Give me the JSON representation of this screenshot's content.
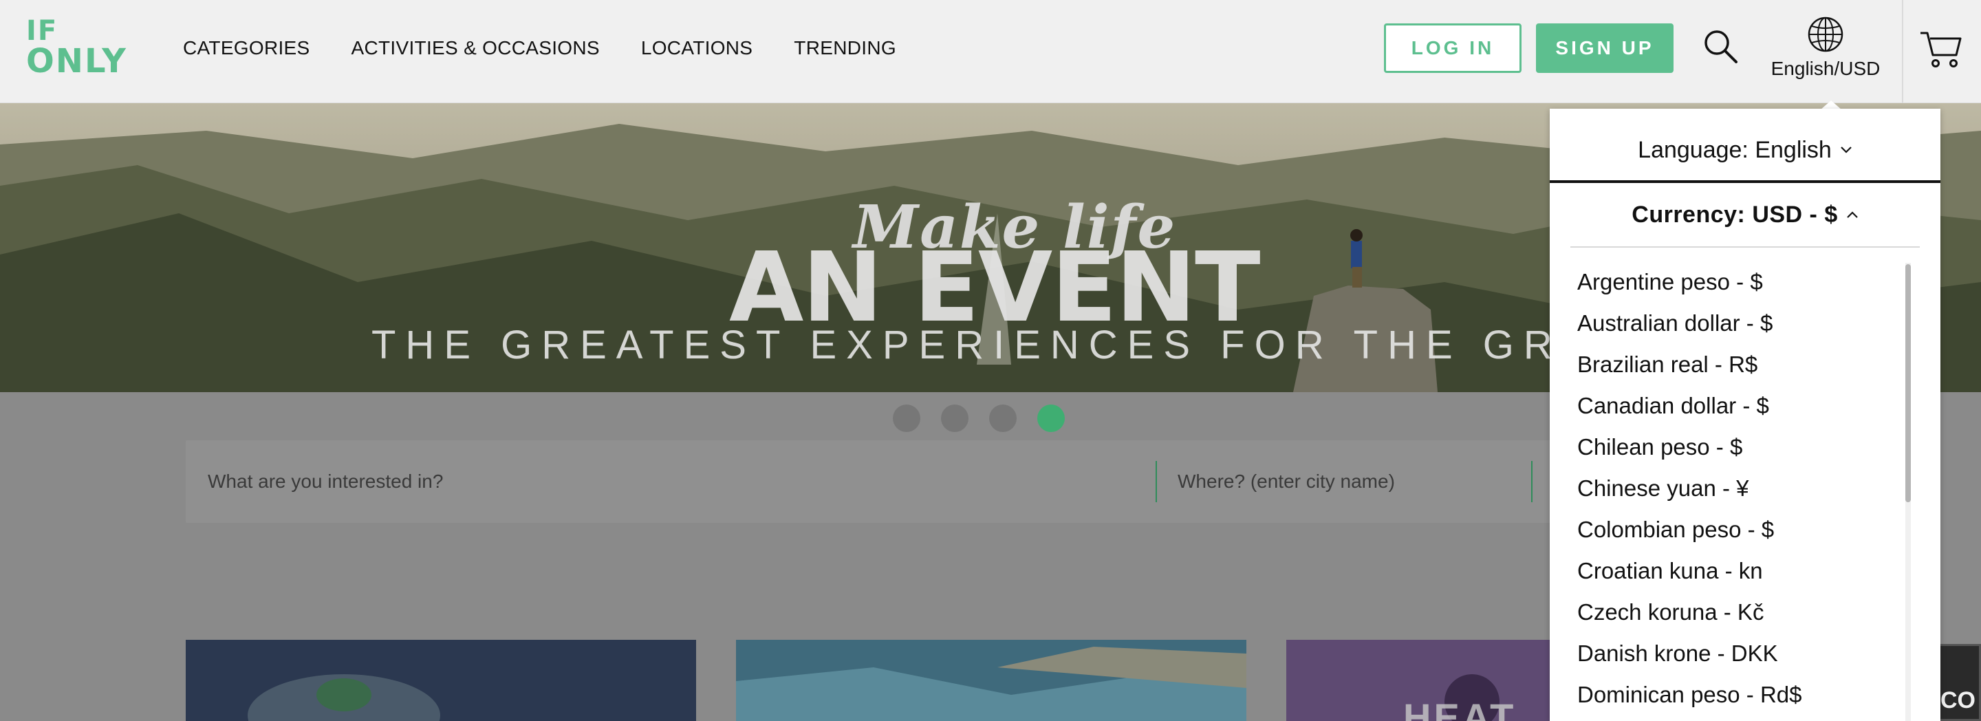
{
  "header": {
    "logo": {
      "line1": "IF",
      "line2": "ONLY"
    },
    "nav": [
      "CATEGORIES",
      "ACTIVITIES & OCCASIONS",
      "LOCATIONS",
      "TRENDING"
    ],
    "login_label": "LOG IN",
    "signup_label": "SIGN UP",
    "locale_label": "English/USD",
    "icons": [
      "search-icon",
      "globe-icon",
      "cart-icon"
    ]
  },
  "hero": {
    "script": "Make life",
    "headline": "AN EVENT",
    "tagline": "THE GREATEST EXPERIENCES FOR THE GREATER GOO"
  },
  "carousel": {
    "count": 4,
    "active_index": 3
  },
  "search": {
    "interest_placeholder": "What are you interested in?",
    "location_placeholder": "Where? (enter city name)"
  },
  "dropdown": {
    "language_label": "Language: English",
    "currency_label": "Currency: USD - $",
    "currencies": [
      "Argentine peso - $",
      "Australian dollar - $",
      "Brazilian real - R$",
      "Canadian dollar - $",
      "Chilean peso - $",
      "Chinese yuan - ¥",
      "Colombian peso - $",
      "Croatian kuna - kn",
      "Czech koruna - Kč",
      "Danish krone - DKK",
      "Dominican peso - Rd$"
    ]
  },
  "cards": {
    "card3_title": "HEAT"
  },
  "chat_tab_label": "CO",
  "colors": {
    "accent": "#5dbf8f",
    "active_dot": "#3fae72",
    "header_bg": "#f0f0f0"
  }
}
